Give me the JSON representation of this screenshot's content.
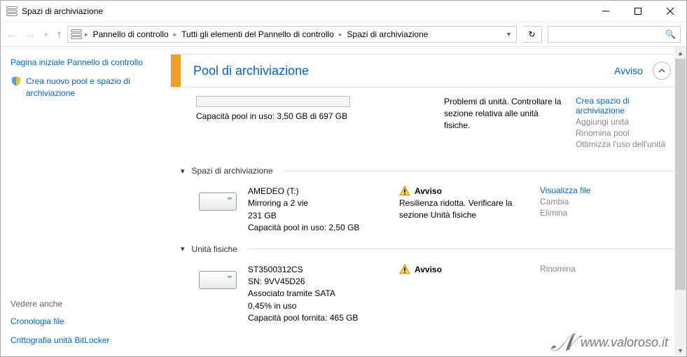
{
  "window": {
    "title": "Spazi di archiviazione"
  },
  "nav": {
    "crumbs": [
      "Pannello di controllo",
      "Tutti gli elementi del Pannello di controllo",
      "Spazi di archiviazione"
    ]
  },
  "sidebar": {
    "link1": "Pagina iniziale Pannello di controllo",
    "link2": "Crea nuovo pool e spazio di archiviazione",
    "seealso": "Vedere anche",
    "link3": "Cronologia file",
    "link4": "Crittografia unità BitLocker"
  },
  "pool": {
    "title": "Pool di archiviazione",
    "status": "Avviso",
    "capacity": "Capacità pool in uso: 3,50 GB di 697 GB",
    "problem": "Problemi di unità. Controllare la sezione relativa alle unità fisiche.",
    "actions": {
      "a1": "Crea spazio di archiviazione",
      "a2": "Aggiungi unità",
      "a3": "Rinomina pool",
      "a4": "Ottimizza l'uso dell'unità"
    }
  },
  "sections": {
    "spaces": "Spazi di archiviazione",
    "physical": "Unità fisiche"
  },
  "space": {
    "name": "AMEDEO (T:)",
    "l2": "Mirroring a 2 vie",
    "l3": "231 GB",
    "l4": "Capacità pool in uso: 2,50 GB",
    "status": "Avviso",
    "detail": "Resilienza ridotta. Verificare la sezione Unità fisiche",
    "a1": "Visualizza file",
    "a2": "Cambia",
    "a3": "Elimina"
  },
  "drive": {
    "l1": "ST3500312CS",
    "l2": "SN: 9VV45D26",
    "l3": "Associato tramite SATA",
    "l4": "0,45% in uso",
    "l5": "Capacità pool fornita: 465 GB",
    "status": "Avviso",
    "a1": "Rinomina"
  },
  "watermark": "www.valoroso.it"
}
